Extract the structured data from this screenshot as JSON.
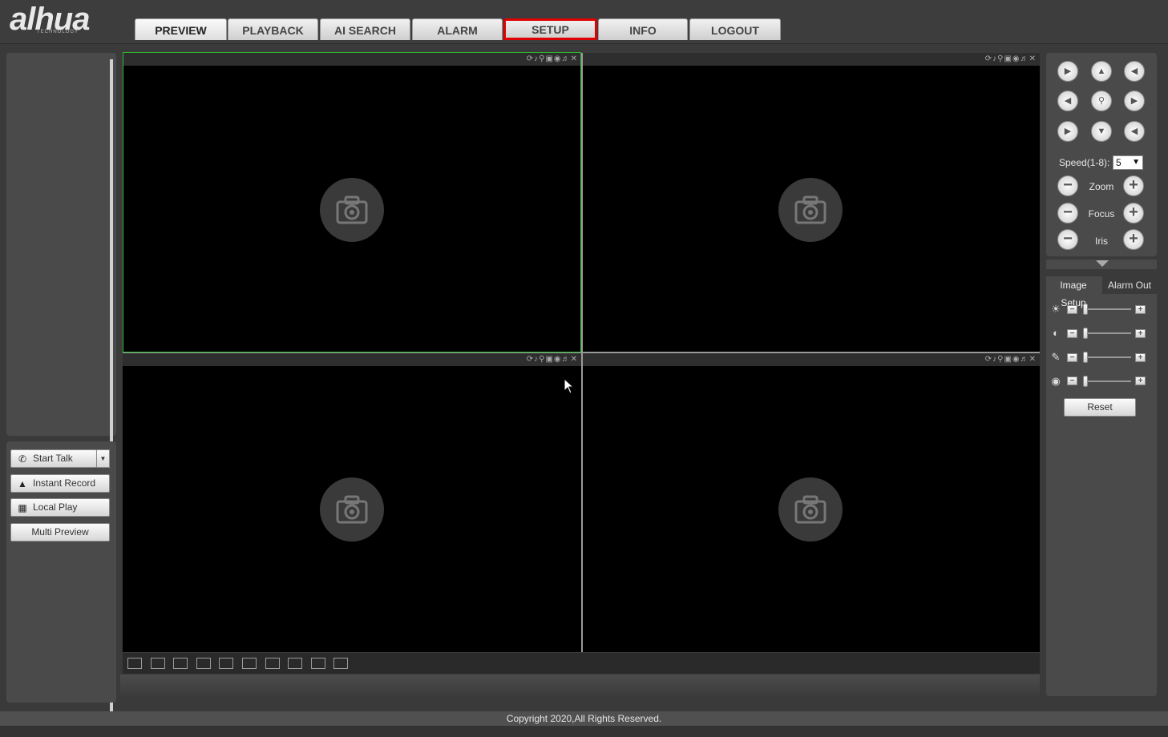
{
  "header": {
    "logo_text": "alhua",
    "logo_sub": "TECHNOLOGY",
    "tabs": [
      {
        "label": "PREVIEW"
      },
      {
        "label": "PLAYBACK"
      },
      {
        "label": "AI SEARCH"
      },
      {
        "label": "ALARM"
      },
      {
        "label": "SETUP"
      },
      {
        "label": "INFO"
      },
      {
        "label": "LOGOUT"
      }
    ],
    "active_tab": "PREVIEW",
    "highlighted_tab": "SETUP",
    "highlight_color": "#e00000"
  },
  "left_panel": {
    "start_talk": "Start Talk",
    "instant_record": "Instant Record",
    "local_play": "Local Play",
    "multi_preview": "Multi Preview"
  },
  "video_grid": {
    "selected_border_color": "#2fb82f",
    "pane_icons": [
      "refresh-icon",
      "mic-icon",
      "zoom-icon",
      "record-icon",
      "snapshot-icon",
      "audio-icon",
      "close-icon"
    ],
    "placeholder_icon": "camera-icon"
  },
  "ptz": {
    "speed_label": "Speed(1-8):",
    "speed_value": "5",
    "zoom_label": "Zoom",
    "focus_label": "Focus",
    "iris_label": "Iris"
  },
  "image_panel": {
    "tabs": [
      "Image Setup",
      "Alarm Out"
    ],
    "active_tab": "Image Setup",
    "sliders": [
      {
        "name": "brightness",
        "icon": "brightness-icon",
        "value": 0
      },
      {
        "name": "contrast",
        "icon": "contrast-icon",
        "value": 0
      },
      {
        "name": "saturation",
        "icon": "saturation-icon",
        "value": 0
      },
      {
        "name": "hue",
        "icon": "hue-icon",
        "value": 0
      }
    ],
    "reset_label": "Reset"
  },
  "footer": {
    "copyright": "Copyright 2020,All Rights Reserved."
  }
}
